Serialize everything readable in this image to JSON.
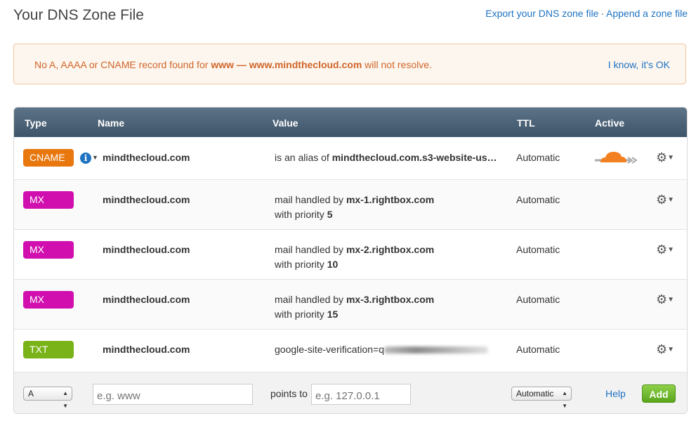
{
  "page": {
    "title": "Your DNS Zone File",
    "export_link": "Export your DNS zone file",
    "separator": "·",
    "append_link": "Append a zone file"
  },
  "alert": {
    "prefix": "No A, AAAA or CNAME record found for ",
    "record": "www",
    "dash": " — ",
    "domain": "www.mindthecloud.com",
    "suffix": " will not resolve.",
    "dismiss": "I know, it's OK"
  },
  "table": {
    "headers": {
      "type": "Type",
      "name": "Name",
      "value": "Value",
      "ttl": "TTL",
      "active": "Active"
    },
    "rows": [
      {
        "type": "CNAME",
        "color": "#e8770e",
        "name": "mindthecloud.com",
        "value_prefix": "is an alias of ",
        "value_bold": "mindthecloud.com.s3-website-us…",
        "ttl": "Automatic"
      },
      {
        "type": "MX",
        "color": "#d00fae",
        "name": "mindthecloud.com",
        "value_prefix": "mail handled by ",
        "value_bold": "mx-1.rightbox.com",
        "priority_label": "with priority ",
        "priority": "5",
        "ttl": "Automatic"
      },
      {
        "type": "MX",
        "color": "#d00fae",
        "name": "mindthecloud.com",
        "value_prefix": "mail handled by ",
        "value_bold": "mx-2.rightbox.com",
        "priority_label": "with priority ",
        "priority": "10",
        "ttl": "Automatic"
      },
      {
        "type": "MX",
        "color": "#d00fae",
        "name": "mindthecloud.com",
        "value_prefix": "mail handled by ",
        "value_bold": "mx-3.rightbox.com",
        "priority_label": "with priority ",
        "priority": "15",
        "ttl": "Automatic"
      },
      {
        "type": "TXT",
        "color": "#7ab317",
        "name": "mindthecloud.com",
        "value_prefix": "google-site-verification=q",
        "ttl": "Automatic"
      }
    ]
  },
  "add_form": {
    "type_value": "A",
    "name_placeholder": "e.g. www",
    "points_to": "points to",
    "value_placeholder": "e.g. 127.0.0.1",
    "ttl_value": "Automatic",
    "help": "Help",
    "add": "Add"
  },
  "icons": {
    "info": "info-icon",
    "gear": "gear-icon",
    "cloud": "cloudflare-cloud-icon",
    "caret": "caret-down-icon"
  }
}
